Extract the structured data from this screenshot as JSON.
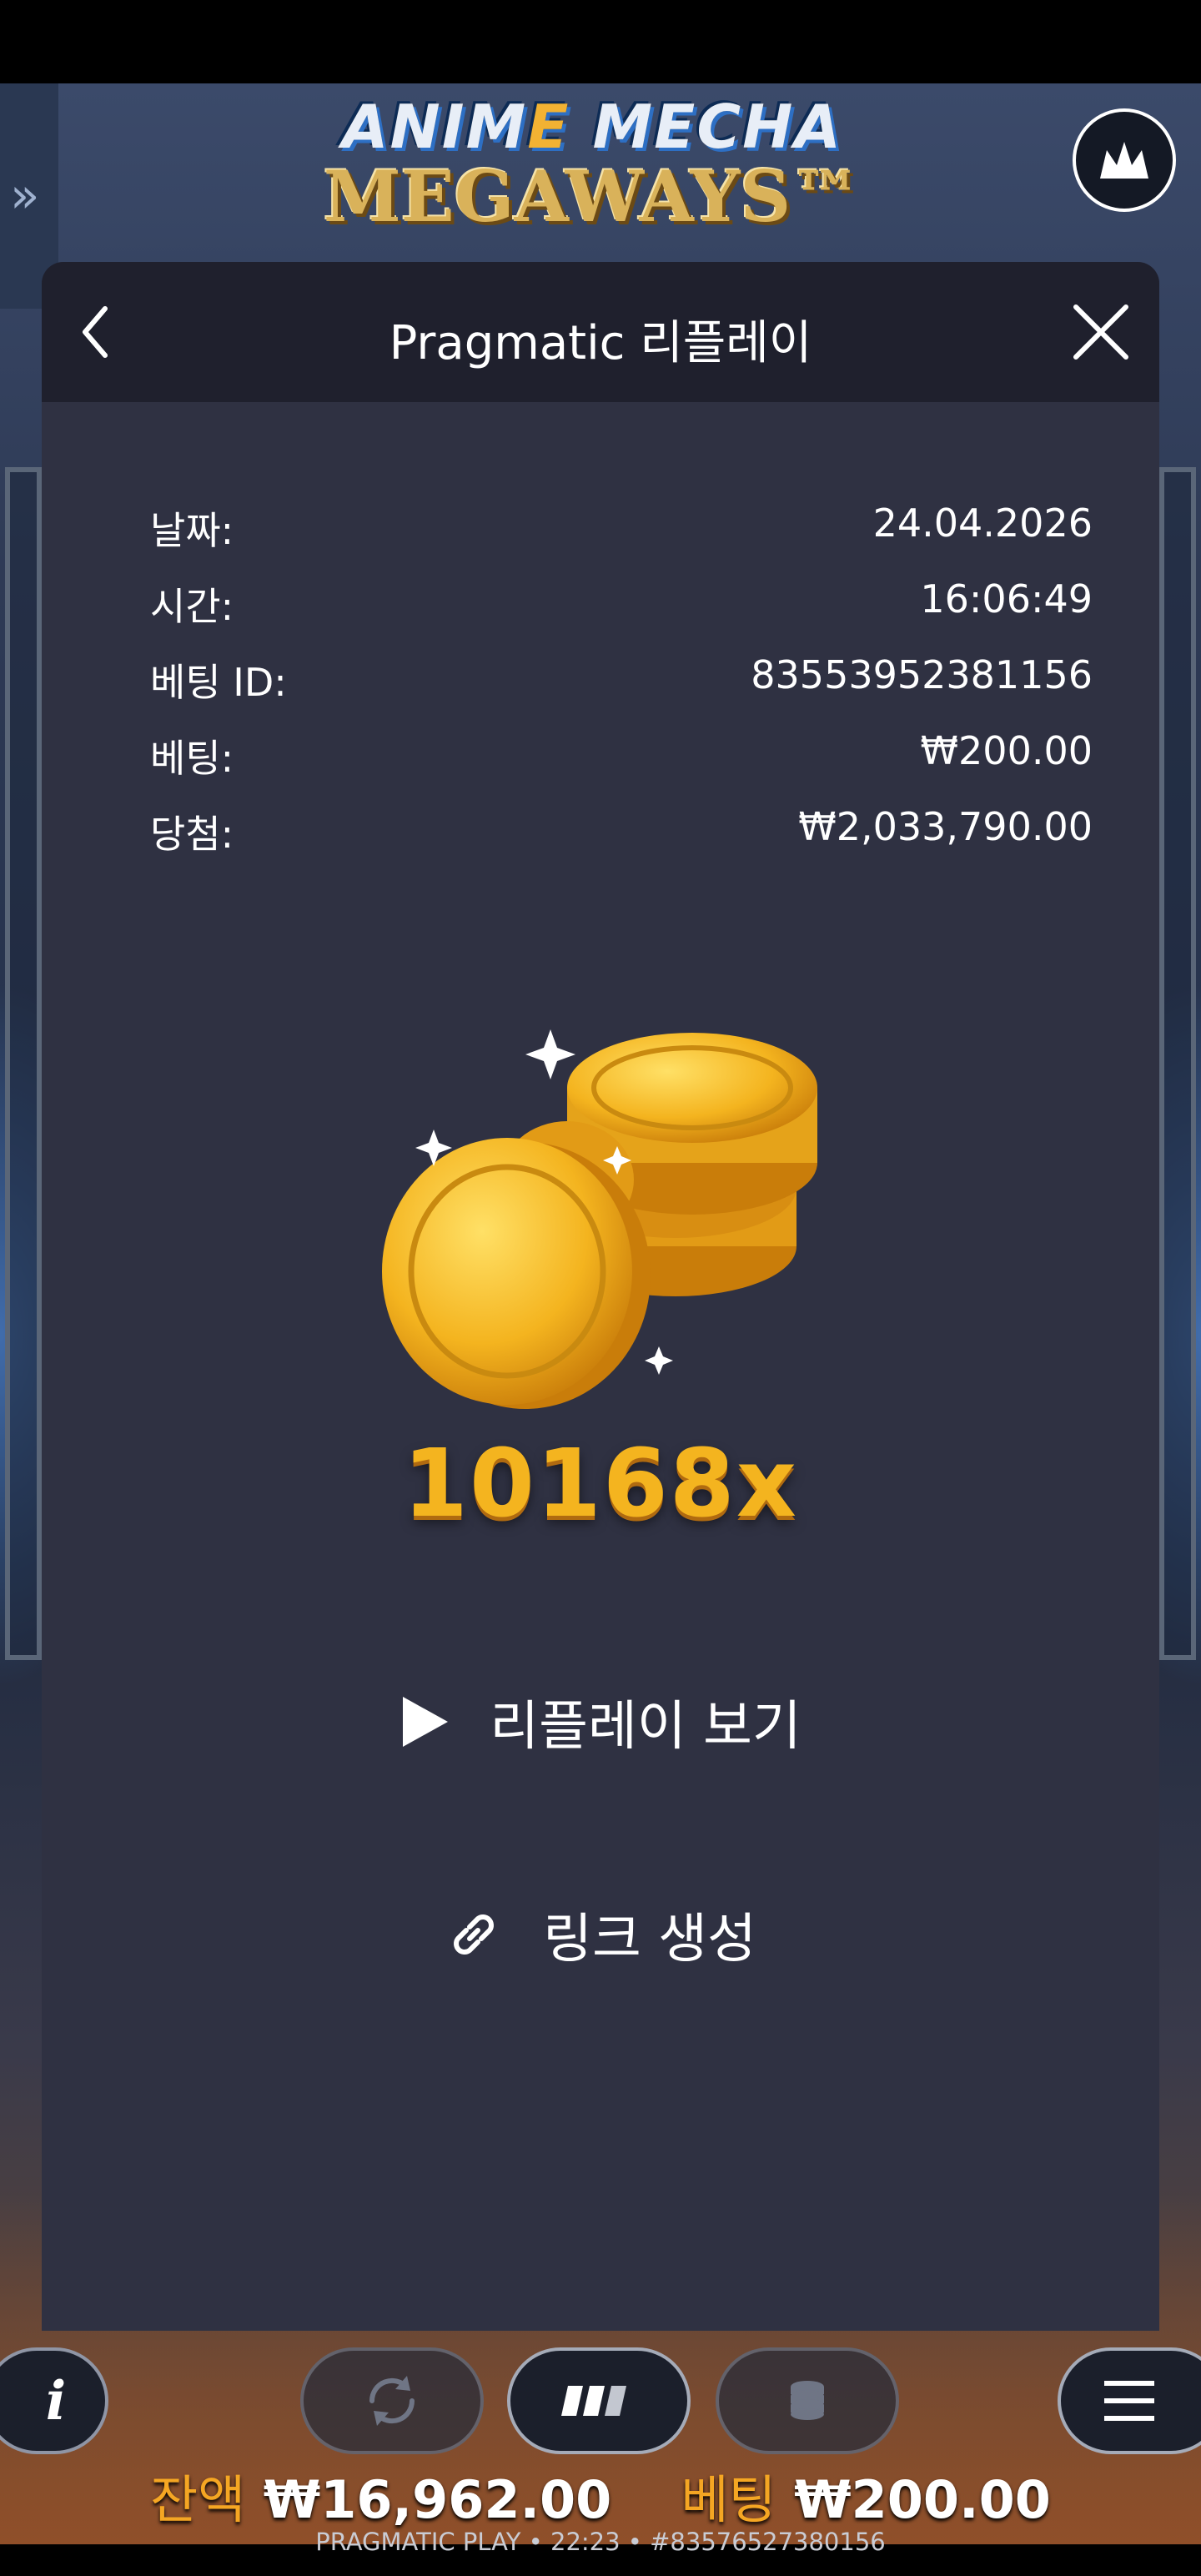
{
  "game": {
    "logo_line1_a": "ANIM",
    "logo_line1_b": "E",
    "logo_line1_c": " MECHA",
    "logo_line2": "MEGAWAYS™",
    "side_handle_glyph": "»"
  },
  "modal": {
    "title": "Pragmatic 리플레이",
    "rows": [
      {
        "label": "날짜:",
        "value": "24.04.2026"
      },
      {
        "label": "시간:",
        "value": "16:06:49"
      },
      {
        "label": "베팅 ID:",
        "value": "83553952381156"
      },
      {
        "label": "베팅:",
        "value": "₩200.00"
      },
      {
        "label": "당첨:",
        "value": "₩2,033,790.00"
      }
    ],
    "multiplier": "10168x",
    "replay_label": "리플레이 보기",
    "link_label": "링크 생성"
  },
  "controls": {
    "info_glyph": "i",
    "balance_label": "잔액",
    "balance_value": "₩16,962.00",
    "bet_label": "베팅",
    "bet_value": "₩200.00",
    "footer": "PRAGMATIC PLAY • 22:23 • #83576527380156"
  },
  "colors": {
    "modal_bg": "#2f3142",
    "header_bg": "#1f202d",
    "gold": "#f4b41f",
    "balance_label": "#f5a623"
  },
  "icons": [
    "chevron-left-icon",
    "close-icon",
    "crown-icon",
    "play-icon",
    "link-icon",
    "autoplay-icon",
    "turbo-icon",
    "coin-stack-icon",
    "hamburger-icon",
    "info-icon"
  ]
}
